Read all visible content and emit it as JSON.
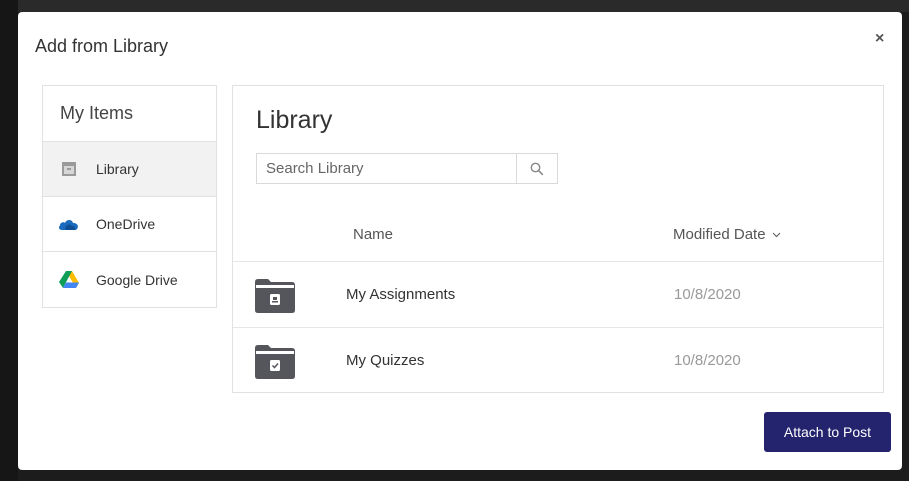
{
  "modal": {
    "title": "Add from Library",
    "close_label": "×",
    "attach_button_label": "Attach to Post",
    "accent_color": "#23236e"
  },
  "sidebar": {
    "header": "My Items",
    "items": [
      {
        "label": "Library",
        "icon": "library-icon",
        "active": true
      },
      {
        "label": "OneDrive",
        "icon": "onedrive-icon",
        "active": false
      },
      {
        "label": "Google Drive",
        "icon": "google-drive-icon",
        "active": false
      }
    ]
  },
  "main": {
    "title": "Library",
    "search": {
      "placeholder": "Search Library",
      "value": "",
      "icon": "search-icon"
    },
    "columns": {
      "name": "Name",
      "modified": "Modified Date",
      "sort_icon": "chevron-down-icon"
    },
    "rows": [
      {
        "name": "My Assignments",
        "modified": "10/8/2020",
        "icon": "assignments-folder-icon"
      },
      {
        "name": "My Quizzes",
        "modified": "10/8/2020",
        "icon": "quizzes-folder-icon"
      }
    ]
  }
}
